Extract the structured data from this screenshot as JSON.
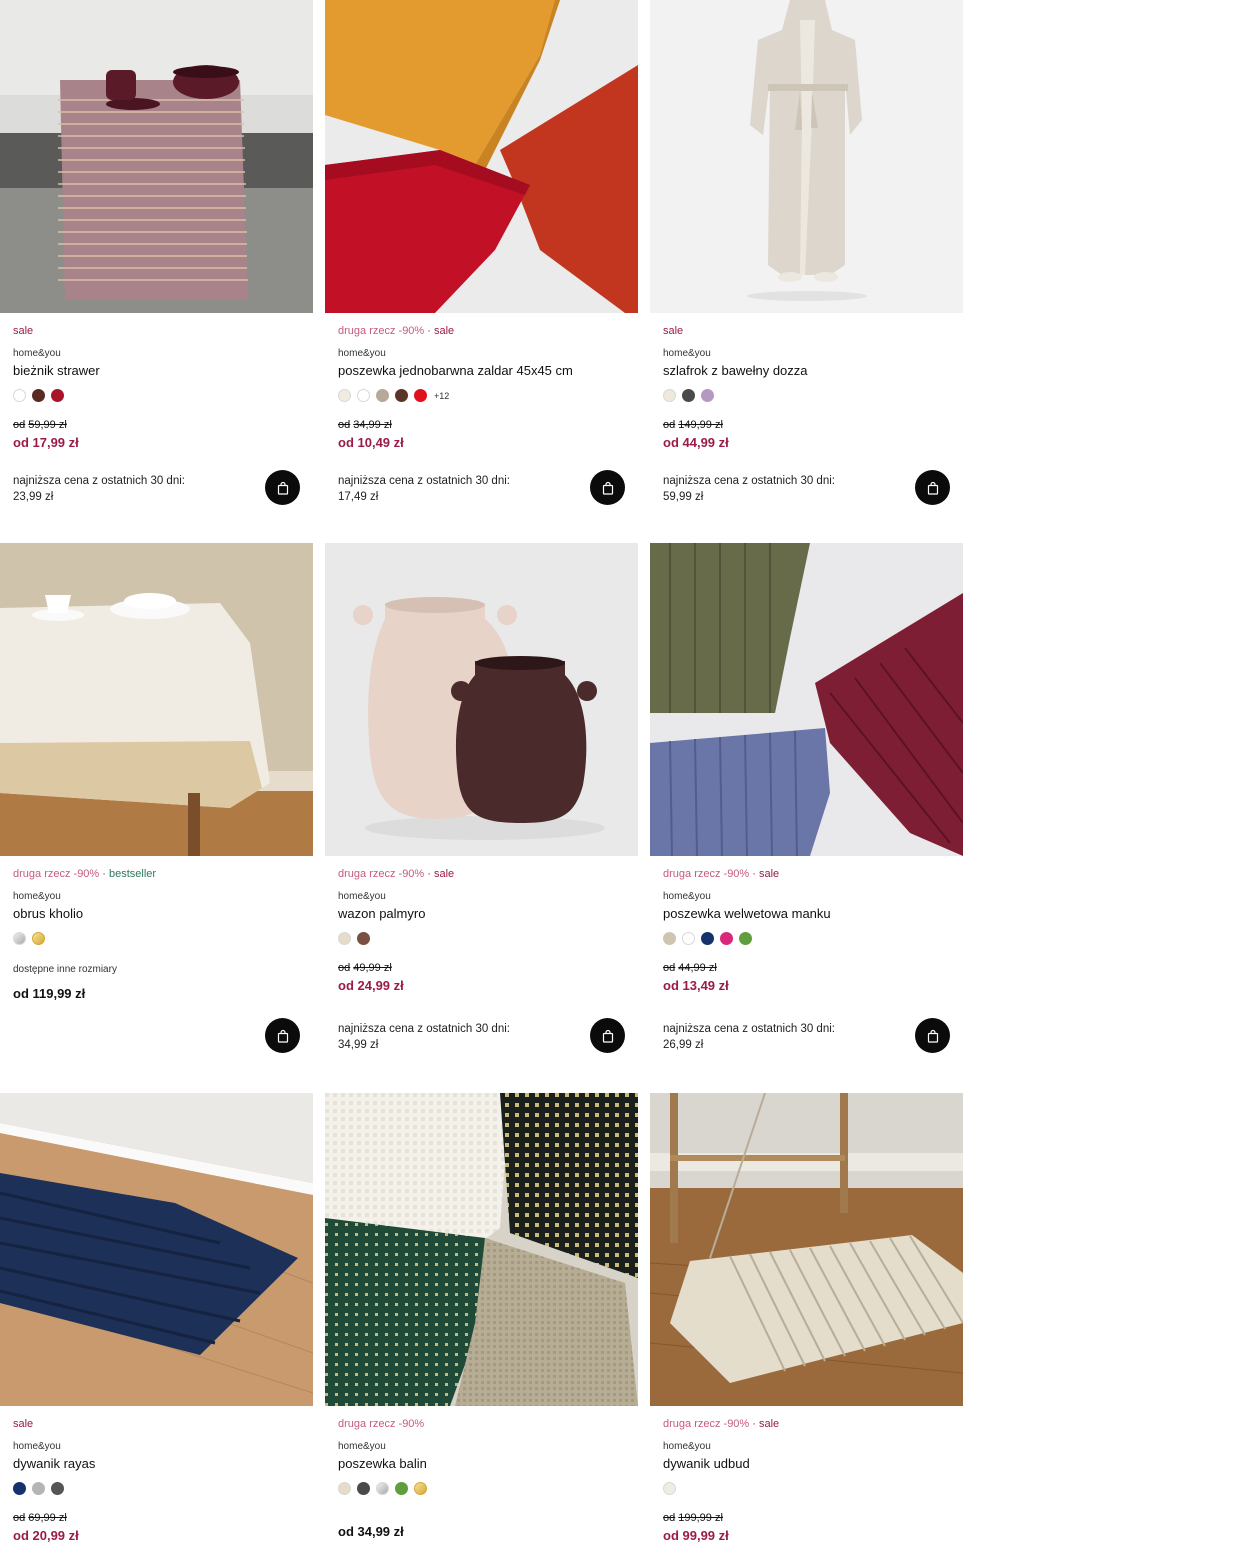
{
  "products": [
    {
      "promo": "",
      "tag": "sale",
      "tag_type": "sale",
      "brand": "home&you",
      "name": "bieżnik strawer",
      "swatches": [
        "#ffffff",
        "#5a2a22",
        "#a8142a"
      ],
      "more": "",
      "old_prefix": "od",
      "old_price": "59,99 zł",
      "new_price": "od 17,99 zł",
      "lowest_label": "najniższa cena z ostatnich 30 dni:",
      "lowest_value": "23,99 zł"
    },
    {
      "promo": "druga rzecz -90%",
      "tag": "sale",
      "tag_type": "sale",
      "brand": "home&you",
      "name": "poszewka jednobarwna zaldar 45x45 cm",
      "swatches": [
        "#f1ece0",
        "#ffffff",
        "#b8a89a",
        "#5b3428",
        "#e0101d"
      ],
      "more": "+12",
      "old_prefix": "od",
      "old_price": "34,99 zł",
      "new_price": "od 10,49 zł",
      "lowest_label": "najniższa cena z ostatnich 30 dni:",
      "lowest_value": "17,49 zł"
    },
    {
      "promo": "",
      "tag": "sale",
      "tag_type": "sale",
      "brand": "home&you",
      "name": "szlafrok z bawełny dozza",
      "swatches": [
        "#efe9dc",
        "#4a4a4a",
        "#b49ac0"
      ],
      "more": "",
      "old_prefix": "od",
      "old_price": "149,99 zł",
      "new_price": "od 44,99 zł",
      "lowest_label": "najniższa cena z ostatnich 30 dni:",
      "lowest_value": "59,99 zł"
    },
    {
      "promo": "druga rzecz -90%",
      "tag": "bestseller",
      "tag_type": "best",
      "brand": "home&you",
      "name": "obrus kholio",
      "swatches": [
        "#c4c4c4",
        "#e3c35a"
      ],
      "more": "",
      "avail": "dostępne inne rozmiary",
      "price": "od 119,99 zł"
    },
    {
      "promo": "druga rzecz -90%",
      "tag": "sale",
      "tag_type": "sale",
      "brand": "home&you",
      "name": "wazon palmyro",
      "swatches": [
        "#e6dcc8",
        "#7a5042"
      ],
      "more": "",
      "old_prefix": "od",
      "old_price": "49,99 zł",
      "new_price": "od 24,99 zł",
      "lowest_label": "najniższa cena z ostatnich 30 dni:",
      "lowest_value": "34,99 zł"
    },
    {
      "promo": "druga rzecz -90%",
      "tag": "sale",
      "tag_type": "sale",
      "brand": "home&you",
      "name": "poszewka welwetowa manku",
      "swatches": [
        "#cfc4ad",
        "#ffffff",
        "#15326e",
        "#d8287a",
        "#5f9e3c"
      ],
      "more": "",
      "old_prefix": "od",
      "old_price": "44,99 zł",
      "new_price": "od 13,49 zł",
      "lowest_label": "najniższa cena z ostatnich 30 dni:",
      "lowest_value": "26,99 zł"
    },
    {
      "promo": "",
      "tag": "sale",
      "tag_type": "sale",
      "brand": "home&you",
      "name": "dywanik rayas",
      "swatches": [
        "#15326e",
        "#b5b5b5",
        "#555555"
      ],
      "more": "",
      "old_prefix": "od",
      "old_price": "69,99 zł",
      "new_price": "od 20,99 zł"
    },
    {
      "promo": "druga rzecz -90%",
      "tag": "",
      "tag_type": "",
      "brand": "home&you",
      "name": "poszewka balin",
      "swatches": [
        "#e6dcc8",
        "#4a4a4a",
        "#c9c9c9",
        "#5f9e3c",
        "#e8c65a"
      ],
      "more": "",
      "price": "od 34,99 zł"
    },
    {
      "promo": "druga rzecz -90%",
      "tag": "sale",
      "tag_type": "sale",
      "brand": "home&you",
      "name": "dywanik udbud",
      "swatches": [
        "#efece4"
      ],
      "more": "",
      "old_prefix": "od",
      "old_price": "199,99 zł",
      "new_price": "od 99,99 zł"
    }
  ]
}
